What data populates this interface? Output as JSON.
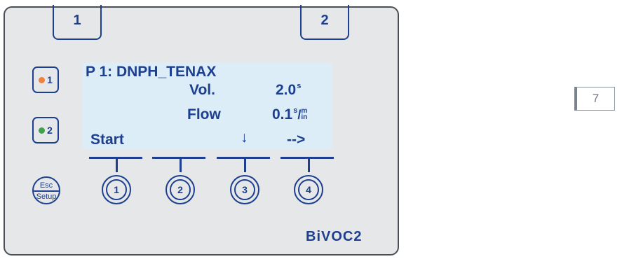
{
  "tabs": {
    "left": "1",
    "right": "2"
  },
  "channels": [
    {
      "label": "1",
      "led_color": "#f0803c"
    },
    {
      "label": "2",
      "led_color": "#3fa24a"
    }
  ],
  "display": {
    "line1": "P 1: DNPH_TENAX",
    "vol_label": "Vol.",
    "vol_value": "2.0",
    "vol_unit": "s",
    "flow_label": "Flow",
    "flow_value": "0.1",
    "flow_unit_top": "s",
    "flow_unit_sep": "/",
    "flow_unit_frac_top": "m",
    "flow_unit_frac_bottom": "in",
    "soft1": "Start",
    "soft3": "↓",
    "soft4": "-->"
  },
  "buttons": {
    "esc_top": "Esc",
    "esc_bottom": "Setup",
    "b1": "1",
    "b2": "2",
    "b3": "3",
    "b4": "4"
  },
  "brand": "BiVOC2",
  "page_number": "7",
  "colors": {
    "primary": "#1c3f8f",
    "panel": "#e6e7e8",
    "lcd": "#dcedf7"
  }
}
